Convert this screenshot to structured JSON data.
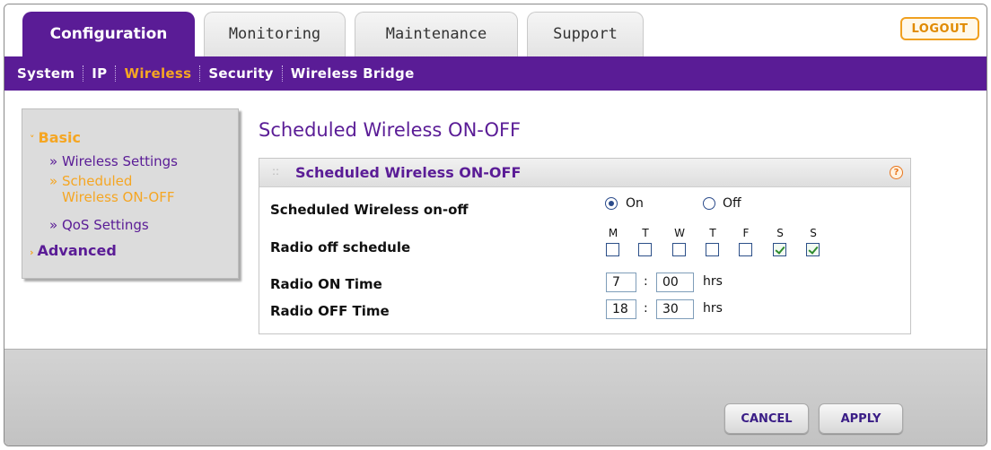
{
  "tabs": [
    {
      "label": "Configuration",
      "active": true
    },
    {
      "label": "Monitoring",
      "active": false
    },
    {
      "label": "Maintenance",
      "active": false
    },
    {
      "label": "Support",
      "active": false
    }
  ],
  "logout_label": "LOGOUT",
  "subnav": [
    {
      "label": "System",
      "active": false
    },
    {
      "label": "IP",
      "active": false
    },
    {
      "label": "Wireless",
      "active": true
    },
    {
      "label": "Security",
      "active": false
    },
    {
      "label": "Wireless Bridge",
      "active": false
    }
  ],
  "sidebar": {
    "basic_label": "Basic",
    "basic_arrow": "˅",
    "items": [
      {
        "label": "» Wireless Settings",
        "active": false
      },
      {
        "label": "» Scheduled",
        "active": true
      },
      {
        "label": "Wireless ON-OFF",
        "active": true
      },
      {
        "label": "» QoS Settings",
        "active": false
      }
    ],
    "advanced_label": "Advanced",
    "advanced_arrow": "›"
  },
  "page_title": "Scheduled Wireless ON-OFF",
  "panel": {
    "title": "Scheduled Wireless ON-OFF",
    "grip": "::",
    "help": "?"
  },
  "form": {
    "onoff_label": "Scheduled Wireless on-off",
    "on_label": "On",
    "off_label": "Off",
    "on_selected": true,
    "schedule_label": "Radio off schedule",
    "days": [
      {
        "letter": "M",
        "checked": false
      },
      {
        "letter": "T",
        "checked": false
      },
      {
        "letter": "W",
        "checked": false
      },
      {
        "letter": "T",
        "checked": false
      },
      {
        "letter": "F",
        "checked": false
      },
      {
        "letter": "S",
        "checked": true
      },
      {
        "letter": "S",
        "checked": true
      }
    ],
    "on_time_label": "Radio ON Time",
    "on_hour": "7",
    "on_min": "00",
    "off_time_label": "Radio OFF Time",
    "off_hour": "18",
    "off_min": "30",
    "colon": ":",
    "unit": "hrs"
  },
  "buttons": {
    "cancel": "CANCEL",
    "apply": "APPLY"
  },
  "colors": {
    "brand_purple": "#5a1c96",
    "accent_orange": "#f5a623"
  }
}
